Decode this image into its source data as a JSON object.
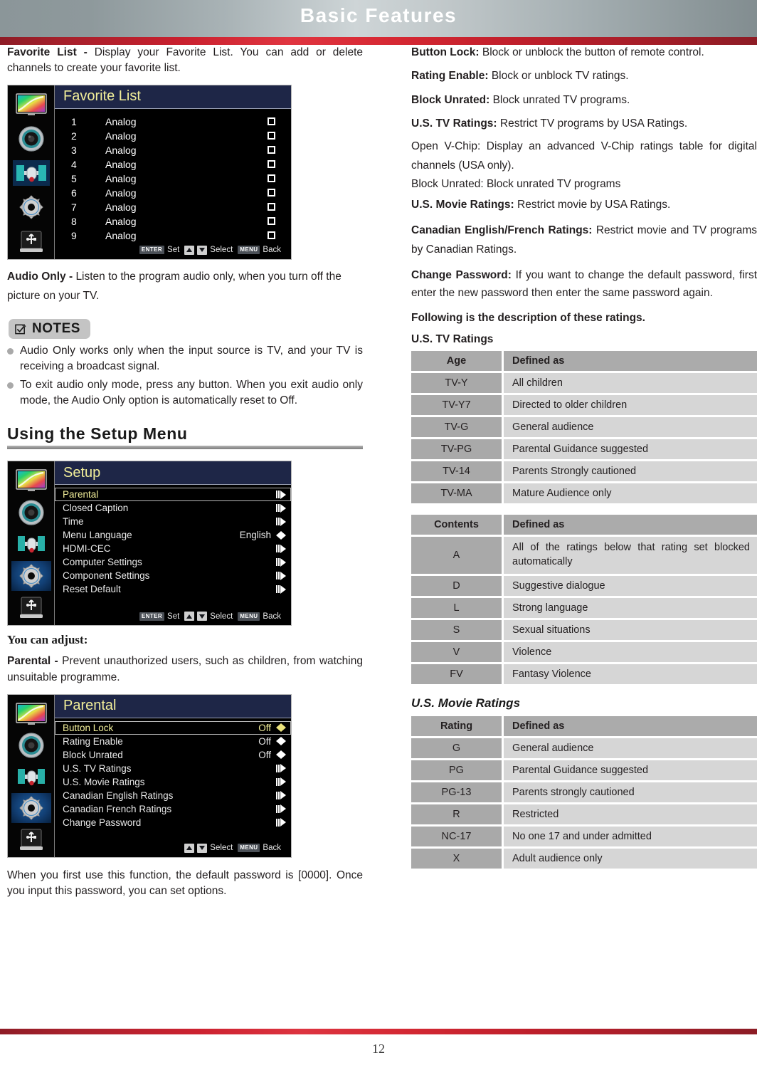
{
  "header": {
    "title": "Basic Features"
  },
  "left": {
    "favorite_list": {
      "lead_bold": "Favorite List - ",
      "lead_text": "Display your Favorite List. You can add or delete channels to create your favorite list."
    },
    "favorite_osd": {
      "title": "Favorite List",
      "channels": [
        {
          "num": "1",
          "name": "Analog"
        },
        {
          "num": "2",
          "name": "Analog"
        },
        {
          "num": "3",
          "name": "Analog"
        },
        {
          "num": "4",
          "name": "Analog"
        },
        {
          "num": "5",
          "name": "Analog"
        },
        {
          "num": "6",
          "name": "Analog"
        },
        {
          "num": "7",
          "name": "Analog"
        },
        {
          "num": "8",
          "name": "Analog"
        },
        {
          "num": "9",
          "name": "Analog"
        }
      ],
      "hints": {
        "enter_key": "ENTER",
        "enter_label": "Set",
        "select_label": "Select",
        "menu_key": "MENU",
        "menu_label": "Back"
      }
    },
    "audio_only": {
      "lead_bold": "Audio Only - ",
      "lead_text": "Listen to the program audio only, when you turn off the picture on your TV."
    },
    "notes": {
      "badge": "NOTES",
      "items": [
        "Audio Only works only when the input source is TV, and your TV is receiving a broadcast signal.",
        "To exit audio only mode, press any button. When you exit audio only mode, the Audio Only option is automatically reset to Off."
      ]
    },
    "setup_section_title": "Using the Setup Menu",
    "setup_osd": {
      "title": "Setup",
      "rows": [
        {
          "name": "Parental",
          "value": "",
          "arrow": "right",
          "selected": true
        },
        {
          "name": "Closed Caption",
          "value": "",
          "arrow": "right",
          "selected": false
        },
        {
          "name": "Time",
          "value": "",
          "arrow": "right",
          "selected": false
        },
        {
          "name": "Menu Language",
          "value": "English",
          "arrow": "lr",
          "selected": false
        },
        {
          "name": "HDMI-CEC",
          "value": "",
          "arrow": "right",
          "selected": false
        },
        {
          "name": "Computer Settings",
          "value": "",
          "arrow": "right",
          "selected": false
        },
        {
          "name": "Component Settings",
          "value": "",
          "arrow": "right",
          "selected": false
        },
        {
          "name": "Reset Default",
          "value": "",
          "arrow": "right",
          "selected": false
        }
      ],
      "hints": {
        "enter_key": "ENTER",
        "enter_label": "Set",
        "select_label": "Select",
        "menu_key": "MENU",
        "menu_label": "Back"
      }
    },
    "you_can_adjust": "You can adjust:",
    "parental_intro": {
      "lead_bold": "Parental - ",
      "lead_text": "Prevent unauthorized users, such as children, from watching unsuitable programme."
    },
    "parental_osd": {
      "title": "Parental",
      "rows": [
        {
          "name": "Button Lock",
          "value": "Off",
          "arrow": "lr",
          "selected": true
        },
        {
          "name": "Rating Enable",
          "value": "Off",
          "arrow": "lr",
          "selected": false
        },
        {
          "name": "Block Unrated",
          "value": "Off",
          "arrow": "lr",
          "selected": false
        },
        {
          "name": "U.S. TV Ratings",
          "value": "",
          "arrow": "right",
          "selected": false
        },
        {
          "name": "U.S. Movie Ratings",
          "value": "",
          "arrow": "right",
          "selected": false
        },
        {
          "name": "Canadian English Ratings",
          "value": "",
          "arrow": "right",
          "selected": false
        },
        {
          "name": "Canadian French Ratings",
          "value": "",
          "arrow": "right",
          "selected": false
        },
        {
          "name": "Change Password",
          "value": "",
          "arrow": "right",
          "selected": false
        }
      ],
      "hints": {
        "select_label": "Select",
        "menu_key": "MENU",
        "menu_label": "Back"
      }
    },
    "password_note": "When you first use this function, the default password is [0000]. Once you input this password, you can set options."
  },
  "right": {
    "paragraphs": [
      {
        "bold": "Button Lock: ",
        "text": "Block or unblock the button of remote control."
      },
      {
        "bold": "Rating Enable: ",
        "text": "Block or unblock TV ratings."
      },
      {
        "bold": "Block Unrated: ",
        "text": "Block unrated TV programs."
      },
      {
        "bold": "U.S. TV Ratings: ",
        "text": "Restrict TV programs by USA Ratings."
      },
      {
        "bold": "",
        "text": "Open V-Chip: Display an advanced V-Chip ratings table for digital channels (USA only)."
      },
      {
        "bold": "",
        "text": "Block Unrated: Block unrated TV programs"
      },
      {
        "bold": "U.S. Movie Ratings: ",
        "text": "Restrict movie by USA Ratings."
      },
      {
        "bold": "Canadian English/French Ratings: ",
        "text": "Restrict movie and TV programs by Canadian Ratings."
      },
      {
        "bold": "Change Password: ",
        "text": "If you want to change the default password, first enter the new password then enter the same password again."
      }
    ],
    "following_line": "Following is the description of these ratings.",
    "us_tv_heading": "U.S. TV Ratings",
    "us_tv_table": {
      "headers": [
        "Age",
        "Defined as"
      ],
      "rows": [
        [
          "TV-Y",
          "All children"
        ],
        [
          "TV-Y7",
          "Directed to older children"
        ],
        [
          "TV-G",
          "General audience"
        ],
        [
          "TV-PG",
          "Parental Guidance suggested"
        ],
        [
          "TV-14",
          "Parents Strongly cautioned"
        ],
        [
          "TV-MA",
          "Mature Audience only"
        ]
      ]
    },
    "contents_table": {
      "headers": [
        "Contents",
        "Defined as"
      ],
      "rows": [
        [
          "A",
          "All of the ratings below that rating set blocked automatically"
        ],
        [
          "D",
          "Suggestive dialogue"
        ],
        [
          "L",
          "Strong language"
        ],
        [
          "S",
          "Sexual situations"
        ],
        [
          "V",
          "Violence"
        ],
        [
          "FV",
          "Fantasy Violence"
        ]
      ]
    },
    "us_movie_heading": "U.S. Movie Ratings",
    "us_movie_table": {
      "headers": [
        "Rating",
        "Defined as"
      ],
      "rows": [
        [
          "G",
          "General audience"
        ],
        [
          "PG",
          "Parental Guidance suggested"
        ],
        [
          "PG-13",
          "Parents strongly cautioned"
        ],
        [
          "R",
          "Restricted"
        ],
        [
          "NC-17",
          "No one 17 and under admitted"
        ],
        [
          "X",
          "Adult audience only"
        ]
      ]
    }
  },
  "footer": {
    "page_number": "12"
  }
}
